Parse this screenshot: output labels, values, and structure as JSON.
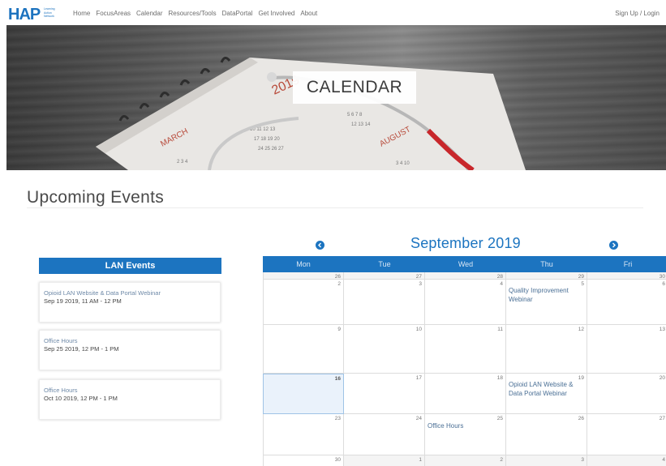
{
  "nav": {
    "logo_text": "HAP",
    "logo_subtext": "Learning Action Network",
    "links": [
      "Home",
      "FocusAreas",
      "Calendar",
      "Resources/Tools",
      "DataPortal",
      "Get Involved",
      "About"
    ],
    "signup": "Sign Up / Login"
  },
  "hero": {
    "title": "CALENDAR"
  },
  "section": {
    "title": "Upcoming Events"
  },
  "lan": {
    "header": "LAN Events",
    "events": [
      {
        "title": "Opioid LAN Website & Data Portal Webinar",
        "time": "Sep 19 2019, 11 AM - 12 PM"
      },
      {
        "title": "Office Hours",
        "time": "Sep 25 2019, 12 PM - 1 PM"
      },
      {
        "title": "Office Hours",
        "time": "Oct 10 2019, 12 PM - 1 PM"
      }
    ]
  },
  "calendar": {
    "month": "September 2019",
    "weekdays": [
      "Mon",
      "Tue",
      "Wed",
      "Thu",
      "Fri"
    ],
    "weeks": [
      [
        {
          "d": "26"
        },
        {
          "d": "27"
        },
        {
          "d": "28"
        },
        {
          "d": "29"
        },
        {
          "d": "30"
        }
      ],
      [
        {
          "d": "2"
        },
        {
          "d": "3"
        },
        {
          "d": "4"
        },
        {
          "d": "5",
          "event": "Quality Improvement Webinar"
        },
        {
          "d": "6"
        }
      ],
      [
        {
          "d": "9"
        },
        {
          "d": "10"
        },
        {
          "d": "11"
        },
        {
          "d": "12"
        },
        {
          "d": "13"
        }
      ],
      [
        {
          "d": "16",
          "today": true
        },
        {
          "d": "17"
        },
        {
          "d": "18"
        },
        {
          "d": "19",
          "event": "Opioid LAN Website & Data Portal Webinar"
        },
        {
          "d": "20"
        }
      ],
      [
        {
          "d": "23"
        },
        {
          "d": "24"
        },
        {
          "d": "25",
          "event": "Office Hours"
        },
        {
          "d": "26"
        },
        {
          "d": "27"
        }
      ],
      [
        {
          "d": "30"
        },
        {
          "d": "1"
        },
        {
          "d": "2"
        },
        {
          "d": "3"
        },
        {
          "d": "4"
        }
      ]
    ],
    "accent": "#1c74c0"
  }
}
